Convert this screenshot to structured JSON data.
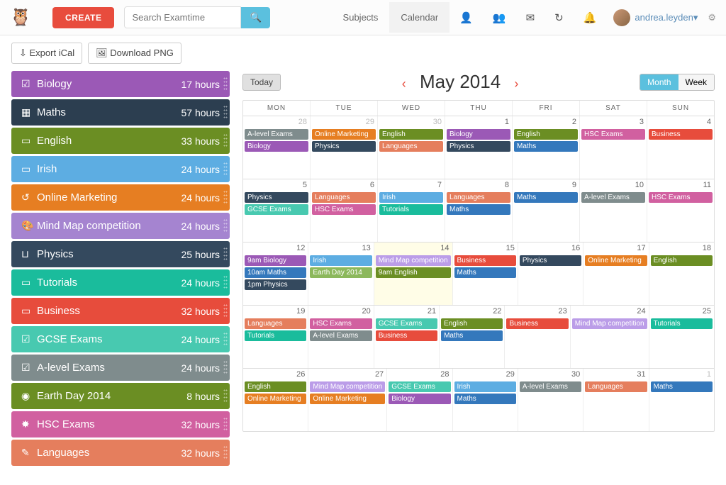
{
  "header": {
    "create": "CREATE",
    "searchPlaceholder": "Search Examtime",
    "subjects": "Subjects",
    "calendar": "Calendar",
    "user": "andrea.leyden"
  },
  "toolbar": {
    "exportIcal": "Export iCal",
    "downloadPng": "Download PNG"
  },
  "subjects": [
    {
      "icon": "☑",
      "name": "Biology",
      "hours": "17 hours",
      "color": "c-purple"
    },
    {
      "icon": "▦",
      "name": "Maths",
      "hours": "57 hours",
      "color": "c-navy"
    },
    {
      "icon": "▭",
      "name": "English",
      "hours": "33 hours",
      "color": "c-olive"
    },
    {
      "icon": "▭",
      "name": "Irish",
      "hours": "24 hours",
      "color": "c-sky"
    },
    {
      "icon": "↺",
      "name": "Online Marketing",
      "hours": "24 hours",
      "color": "c-orange"
    },
    {
      "icon": "🎨",
      "name": "Mind Map competition",
      "hours": "24 hours",
      "color": "c-violet"
    },
    {
      "icon": "⊔",
      "name": "Physics",
      "hours": "25 hours",
      "color": "c-dark"
    },
    {
      "icon": "▭",
      "name": "Tutorials",
      "hours": "24 hours",
      "color": "c-teal"
    },
    {
      "icon": "▭",
      "name": "Business",
      "hours": "32 hours",
      "color": "c-red"
    },
    {
      "icon": "☑",
      "name": "GCSE Exams",
      "hours": "24 hours",
      "color": "c-tealish"
    },
    {
      "icon": "☑",
      "name": "A-level Exams",
      "hours": "24 hours",
      "color": "c-grey"
    },
    {
      "icon": "◉",
      "name": "Earth Day 2014",
      "hours": "8 hours",
      "color": "c-green"
    },
    {
      "icon": "✸",
      "name": "HSC Exams",
      "hours": "32 hours",
      "color": "c-magenta"
    },
    {
      "icon": "✎",
      "name": "Languages",
      "hours": "32 hours",
      "color": "c-coral"
    }
  ],
  "cal": {
    "today": "Today",
    "title": "May 2014",
    "month": "Month",
    "week": "Week",
    "daysHead": [
      "MON",
      "TUE",
      "WED",
      "THU",
      "FRI",
      "SAT",
      "SUN"
    ]
  },
  "weeks": [
    [
      {
        "n": "28",
        "o": true,
        "e": [
          [
            "A-level Exams",
            "c-grey"
          ],
          [
            "Biology",
            "c-purple"
          ]
        ]
      },
      {
        "n": "29",
        "o": true,
        "e": [
          [
            "Online Marketing",
            "c-orange"
          ],
          [
            "Physics",
            "c-dark"
          ]
        ]
      },
      {
        "n": "30",
        "o": true,
        "e": [
          [
            "English",
            "c-olive"
          ],
          [
            "Languages",
            "c-coral"
          ]
        ]
      },
      {
        "n": "1",
        "e": [
          [
            "Biology",
            "c-purple"
          ],
          [
            "Physics",
            "c-dark"
          ]
        ]
      },
      {
        "n": "2",
        "e": [
          [
            "English",
            "c-olive"
          ],
          [
            "Maths",
            "c-blue"
          ]
        ]
      },
      {
        "n": "3",
        "e": [
          [
            "HSC Exams",
            "c-magenta"
          ]
        ]
      },
      {
        "n": "4",
        "e": [
          [
            "Business",
            "c-red"
          ]
        ]
      }
    ],
    [
      {
        "n": "5",
        "e": [
          [
            "Physics",
            "c-dark"
          ],
          [
            "GCSE Exams",
            "c-tealish"
          ]
        ]
      },
      {
        "n": "6",
        "e": [
          [
            "Languages",
            "c-coral"
          ],
          [
            "HSC Exams",
            "c-magenta"
          ]
        ]
      },
      {
        "n": "7",
        "e": [
          [
            "Irish",
            "c-sky"
          ],
          [
            "Tutorials",
            "c-teal"
          ]
        ]
      },
      {
        "n": "8",
        "e": [
          [
            "Languages",
            "c-coral"
          ],
          [
            "Maths",
            "c-blue"
          ]
        ]
      },
      {
        "n": "9",
        "e": [
          [
            "Maths",
            "c-blue"
          ]
        ]
      },
      {
        "n": "10",
        "e": [
          [
            "A-level Exams",
            "c-grey"
          ]
        ]
      },
      {
        "n": "11",
        "e": [
          [
            "HSC Exams",
            "c-magenta"
          ]
        ]
      }
    ],
    [
      {
        "n": "12",
        "e": [
          [
            "9am Biology",
            "c-purple"
          ],
          [
            "10am Maths",
            "c-blue"
          ],
          [
            "1pm Physics",
            "c-dark"
          ]
        ]
      },
      {
        "n": "13",
        "e": [
          [
            "Irish",
            "c-sky"
          ],
          [
            "Earth Day 2014",
            "c-lgreen"
          ]
        ]
      },
      {
        "n": "14",
        "t": true,
        "e": [
          [
            "Mind Map competition",
            "c-lviolet"
          ],
          [
            "9am English",
            "c-olive"
          ]
        ]
      },
      {
        "n": "15",
        "e": [
          [
            "Business",
            "c-red"
          ],
          [
            "Maths",
            "c-blue"
          ]
        ]
      },
      {
        "n": "16",
        "e": [
          [
            "Physics",
            "c-dark"
          ]
        ]
      },
      {
        "n": "17",
        "e": [
          [
            "Online Marketing",
            "c-orange"
          ]
        ]
      },
      {
        "n": "18",
        "e": [
          [
            "English",
            "c-olive"
          ]
        ]
      }
    ],
    [
      {
        "n": "19",
        "e": [
          [
            "Languages",
            "c-coral"
          ],
          [
            "Tutorials",
            "c-teal"
          ]
        ]
      },
      {
        "n": "20",
        "e": [
          [
            "HSC Exams",
            "c-magenta"
          ],
          [
            "A-level Exams",
            "c-grey"
          ]
        ]
      },
      {
        "n": "21",
        "e": [
          [
            "GCSE Exams",
            "c-tealish"
          ],
          [
            "Business",
            "c-red"
          ]
        ]
      },
      {
        "n": "22",
        "e": [
          [
            "English",
            "c-olive"
          ],
          [
            "Maths",
            "c-blue"
          ]
        ]
      },
      {
        "n": "23",
        "e": [
          [
            "Business",
            "c-red"
          ]
        ]
      },
      {
        "n": "24",
        "e": [
          [
            "Mind Map competition",
            "c-lviolet"
          ]
        ]
      },
      {
        "n": "25",
        "e": [
          [
            "Tutorials",
            "c-teal"
          ]
        ]
      }
    ],
    [
      {
        "n": "26",
        "e": [
          [
            "English",
            "c-olive"
          ],
          [
            "Online Marketing",
            "c-orange"
          ]
        ]
      },
      {
        "n": "27",
        "e": [
          [
            "Mind Map competition",
            "c-lviolet"
          ],
          [
            "Online Marketing",
            "c-orange"
          ]
        ]
      },
      {
        "n": "28",
        "e": [
          [
            "GCSE Exams",
            "c-tealish"
          ],
          [
            "Biology",
            "c-purple"
          ]
        ]
      },
      {
        "n": "29",
        "e": [
          [
            "Irish",
            "c-sky"
          ],
          [
            "Maths",
            "c-blue"
          ]
        ]
      },
      {
        "n": "30",
        "e": [
          [
            "A-level Exams",
            "c-grey"
          ]
        ]
      },
      {
        "n": "31",
        "e": [
          [
            "Languages",
            "c-coral"
          ]
        ]
      },
      {
        "n": "1",
        "o": true,
        "e": [
          [
            "Maths",
            "c-blue"
          ]
        ]
      }
    ]
  ]
}
